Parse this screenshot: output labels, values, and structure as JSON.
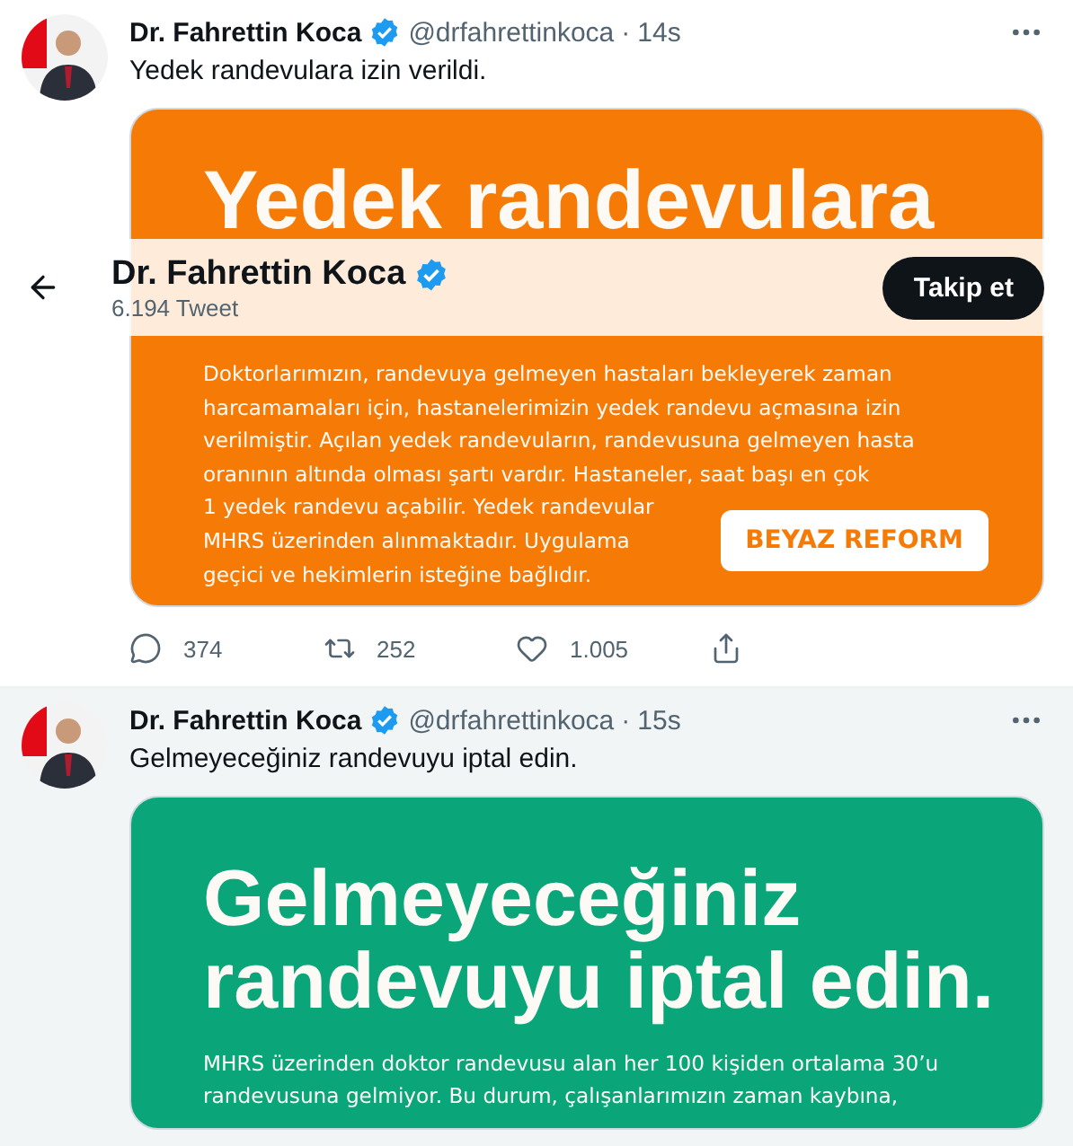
{
  "header": {
    "title": "Dr. Fahrettin Koca",
    "verified": true,
    "subtitle": "6.194 Tweet",
    "follow_button": "Takip et"
  },
  "tweets": [
    {
      "name": "Dr. Fahrettin Koca",
      "verified": true,
      "handle": "@drfahrettinkoca",
      "separator": "·",
      "time": "14s",
      "text": "Yedek randevulara izin verildi.",
      "hovered": false,
      "card": {
        "color": "#f57a06",
        "headline": [
          "Yedek randevulara"
        ],
        "body": "Doktorlarımızın, randevuya gelmeyen hastaları bekleyerek zaman harcamamaları için, hastanelerimizin yedek randevu açmasına izin verilmiştir. Açılan yedek randevuların, randevusuna gelmeyen hasta oranının altında olması şartı vardır. Hastaneler, saat başı en çok",
        "body_continued": "1 yedek randevu açabilir. Yedek randevular MHRS üzerinden alınmaktadır. Uygulama geçici ve hekimlerin isteğine bağlıdır.",
        "badge": "BEYAZ REFORM"
      },
      "actions": [
        {
          "kind": "reply",
          "count": "374"
        },
        {
          "kind": "retweet",
          "count": "252"
        },
        {
          "kind": "like",
          "count": "1.005"
        },
        {
          "kind": "share"
        }
      ]
    },
    {
      "name": "Dr. Fahrettin Koca",
      "verified": true,
      "handle": "@drfahrettinkoca",
      "separator": "·",
      "time": "15s",
      "text": "Gelmeyeceğiniz randevuyu iptal edin.",
      "hovered": true,
      "card": {
        "color": "#0aa67a",
        "headline": [
          "Gelmeyeceğiniz",
          "randevuyu iptal edin."
        ],
        "body": "MHRS üzerinden doktor randevusu alan her 100 kişiden ortalama 30’u randevusuna gelmiyor. Bu durum, çalışanlarımızın zaman kaybına,"
      }
    }
  ]
}
